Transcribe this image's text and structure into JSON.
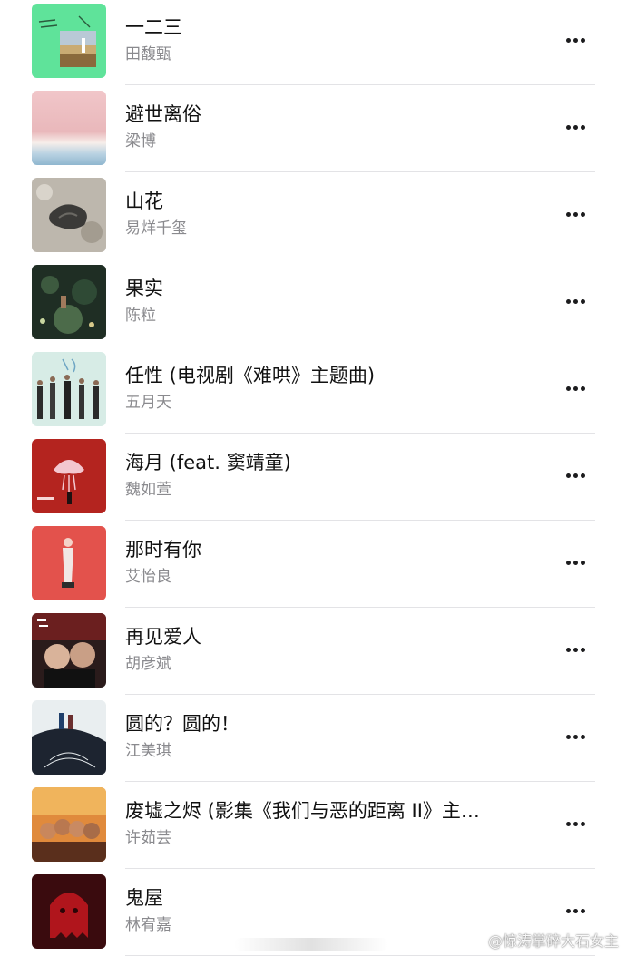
{
  "songs": [
    {
      "title": "一二三",
      "artist": "田馥甄",
      "cover_icon": "album-art-green-field"
    },
    {
      "title": "避世离俗",
      "artist": "梁博",
      "cover_icon": "album-art-pink-sky"
    },
    {
      "title": "山花",
      "artist": "易烊千玺",
      "cover_icon": "album-art-stone"
    },
    {
      "title": "果实",
      "artist": "陈粒",
      "cover_icon": "album-art-dark-forest"
    },
    {
      "title": "任性 (电视剧《难哄》主题曲)",
      "artist": "五月天",
      "cover_icon": "album-art-band"
    },
    {
      "title": "海月 (feat. 窦靖童)",
      "artist": "魏如萱",
      "cover_icon": "album-art-red-jellyfish"
    },
    {
      "title": "那时有你",
      "artist": "艾怡良",
      "cover_icon": "album-art-red-figure"
    },
    {
      "title": "再见爱人",
      "artist": "胡彦斌",
      "cover_icon": "album-art-two-portraits"
    },
    {
      "title": "圆的？圆的！",
      "artist": "江美琪",
      "cover_icon": "album-art-spiral"
    },
    {
      "title": "废墟之烬 (影集《我们与恶的距离 II》主…",
      "artist": "许茹芸",
      "cover_icon": "album-art-group-sunset"
    },
    {
      "title": "鬼屋",
      "artist": "林宥嘉",
      "cover_icon": "album-art-red-ghost"
    }
  ],
  "watermark": {
    "text": "@惊涛掌碎大石女主"
  },
  "colors": {
    "title": "#111111",
    "artist": "#8a8a8e",
    "divider": "#e3e3e6"
  }
}
